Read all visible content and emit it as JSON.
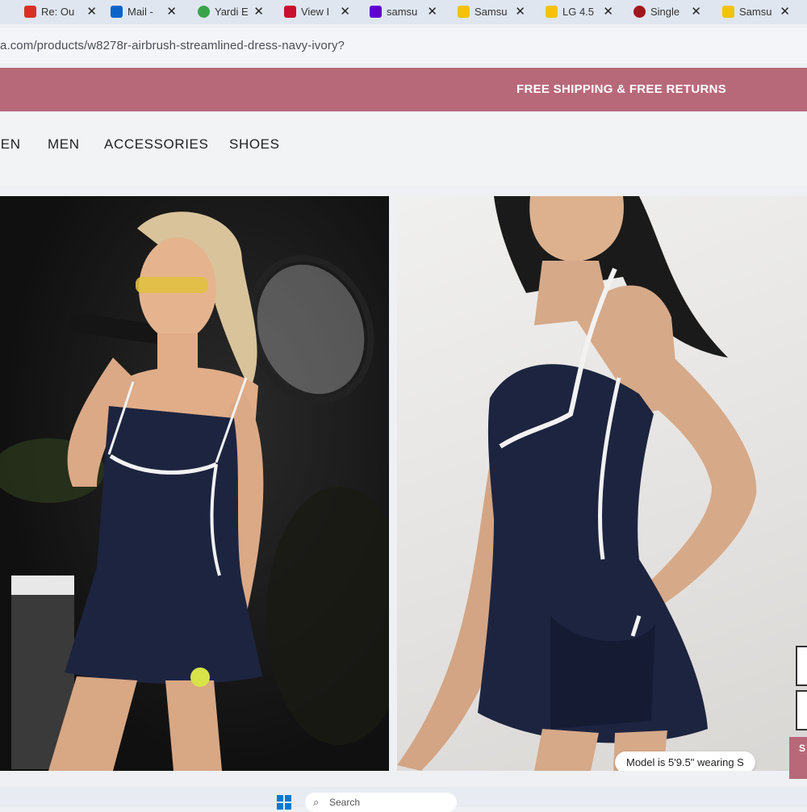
{
  "tabs": [
    {
      "title": "Re: Ou",
      "favicon": "gmail-icon",
      "color": "#d93025"
    },
    {
      "title": "Mail -",
      "favicon": "outlook-icon",
      "color": "#0a64c8"
    },
    {
      "title": "Yardi E",
      "favicon": "yardi-icon",
      "color": "#3aa34a"
    },
    {
      "title": "View I",
      "favicon": "view-icon",
      "color": "#c8102e"
    },
    {
      "title": "samsu",
      "favicon": "yahoo-icon",
      "color": "#5f01d1"
    },
    {
      "title": "Samsu",
      "favicon": "samsung-icon",
      "color": "#f4c20d"
    },
    {
      "title": "LG 4.5",
      "favicon": "lg-icon",
      "color": "#f4c20d"
    },
    {
      "title": "Single",
      "favicon": "single-icon",
      "color": "#a3161e"
    },
    {
      "title": "Samsu",
      "favicon": "samsung-icon",
      "color": "#f4c20d"
    }
  ],
  "tab_close_glyph": "✕",
  "address_bar": {
    "url": "a.com/products/w8278r-airbrush-streamlined-dress-navy-ivory?"
  },
  "promo": {
    "text": "FREE SHIPPING & FREE RETURNS"
  },
  "nav": {
    "items": [
      "MEN",
      "MEN",
      "ACCESSORIES",
      "SHOES"
    ]
  },
  "product": {
    "model_note": "Model is 5'9.5\" wearing S"
  },
  "side": {
    "button_letter": "S"
  },
  "taskbar": {
    "search_placeholder": "Search"
  },
  "colors": {
    "promo": "#b86979",
    "dress": "#1d2440",
    "piping": "#f2f2f2"
  }
}
